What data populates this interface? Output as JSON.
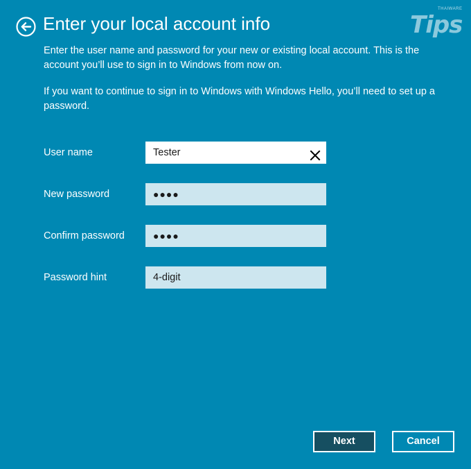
{
  "header": {
    "title": "Enter your local account info",
    "back_icon": "back-arrow-circle-icon"
  },
  "watermark": {
    "text": "Tips",
    "small_text": "THAIWARE"
  },
  "description": {
    "paragraph1": "Enter the user name and password for your new or existing local account. This is the account you’ll use to sign in to Windows from now on.",
    "paragraph2": "If you want to continue to sign in to Windows with Windows Hello, you’ll need to set up a password."
  },
  "form": {
    "username": {
      "label": "User name",
      "value": "Tester"
    },
    "new_password": {
      "label": "New password",
      "value": "●●●●"
    },
    "confirm_password": {
      "label": "Confirm password",
      "value": "●●●●"
    },
    "password_hint": {
      "label": "Password hint",
      "value": "4-digit"
    }
  },
  "buttons": {
    "next": "Next",
    "cancel": "Cancel"
  },
  "colors": {
    "background": "#0088b3",
    "field_inactive": "#cde6ef",
    "field_active": "#ffffff",
    "primary_button": "#164f61"
  }
}
